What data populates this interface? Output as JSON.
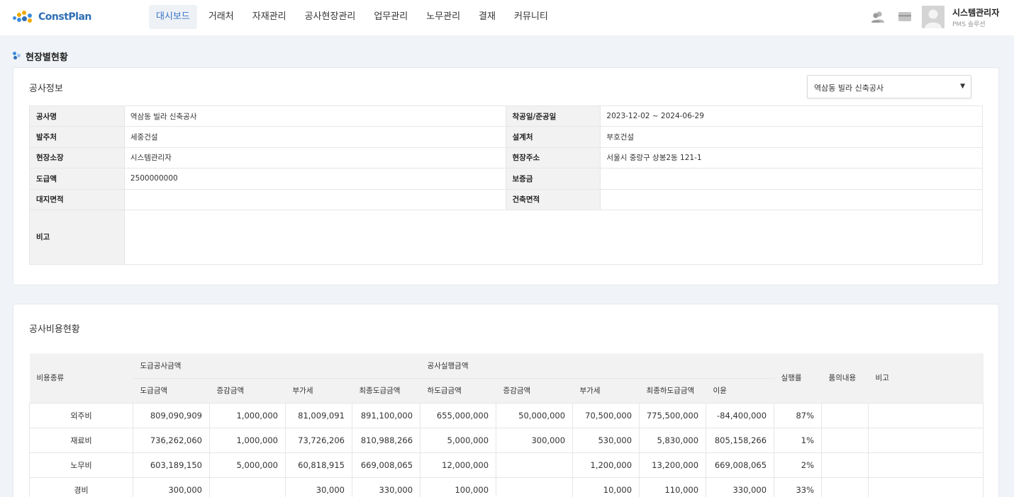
{
  "app": {
    "logo_text": "ConstPlan",
    "nav": [
      {
        "label": "대시보드",
        "active": true
      },
      {
        "label": "거래처"
      },
      {
        "label": "자재관리"
      },
      {
        "label": "공사현장관리"
      },
      {
        "label": "업무관리"
      },
      {
        "label": "노무관리"
      },
      {
        "label": "결재"
      },
      {
        "label": "커뮤니티"
      }
    ],
    "user": {
      "name": "시스템관리자",
      "subtitle": "PMS 솔루션"
    },
    "header_icons": [
      "users-icon",
      "card-icon",
      "avatar"
    ]
  },
  "page": {
    "title": "현장별현황"
  },
  "project_info": {
    "title": "공사정보",
    "selected_site": "역삼동 빌라 신축공사",
    "rows": [
      {
        "l1": "공사명",
        "v1": "역삼동 빌라 신축공사",
        "l2": "착공일/준공일",
        "v2": "2023-12-02 ~ 2024-06-29"
      },
      {
        "l1": "발주처",
        "v1": "세중건설",
        "l2": "설계처",
        "v2": "부호건설"
      },
      {
        "l1": "현장소장",
        "v1": "시스템관리자",
        "l2": "현장주소",
        "v2": "서울시 중랑구 상봉2동 121-1"
      },
      {
        "l1": "도급액",
        "v1": "2500000000",
        "l2": "보증금",
        "v2": ""
      },
      {
        "l1": "대지면적",
        "v1": "",
        "l2": "건축면적",
        "v2": ""
      }
    ],
    "remarks_label": "비고",
    "remarks_value": ""
  },
  "cost_status": {
    "title": "공사비용현황",
    "headers": {
      "cost_type": "비용종류",
      "contract_group": "도급공사금액",
      "execution_group": "공사실행금액",
      "exec_rate": "실행률",
      "approval": "품의내용",
      "note": "비고",
      "contract_cols": [
        "도급금액",
        "증감금액",
        "부가세",
        "최종도급금액"
      ],
      "execution_cols": [
        "하도급금액",
        "증감금액",
        "부가세",
        "최종하도급금액",
        "이윤"
      ]
    },
    "rows": [
      {
        "type": "외주비",
        "cells": [
          "809,090,909",
          "1,000,000",
          "81,009,091",
          "891,100,000",
          "655,000,000",
          "50,000,000",
          "70,500,000",
          "775,500,000",
          "-84,400,000",
          "87%",
          "",
          ""
        ]
      },
      {
        "type": "재료비",
        "cells": [
          "736,262,060",
          "1,000,000",
          "73,726,206",
          "810,988,266",
          "5,000,000",
          "300,000",
          "530,000",
          "5,830,000",
          "805,158,266",
          "1%",
          "",
          ""
        ]
      },
      {
        "type": "노무비",
        "cells": [
          "603,189,150",
          "5,000,000",
          "60,818,915",
          "669,008,065",
          "12,000,000",
          "",
          "1,200,000",
          "13,200,000",
          "669,008,065",
          "2%",
          "",
          ""
        ]
      },
      {
        "type": "경비",
        "cells": [
          "300,000",
          "",
          "30,000",
          "330,000",
          "100,000",
          "",
          "10,000",
          "110,000",
          "330,000",
          "33%",
          "",
          ""
        ]
      }
    ]
  },
  "colors": {
    "accent": "#3b73c8",
    "logo_blue": "#2f6fb5",
    "header_bg": "#f2f2f2",
    "page_bg": "#f0f3f7"
  }
}
